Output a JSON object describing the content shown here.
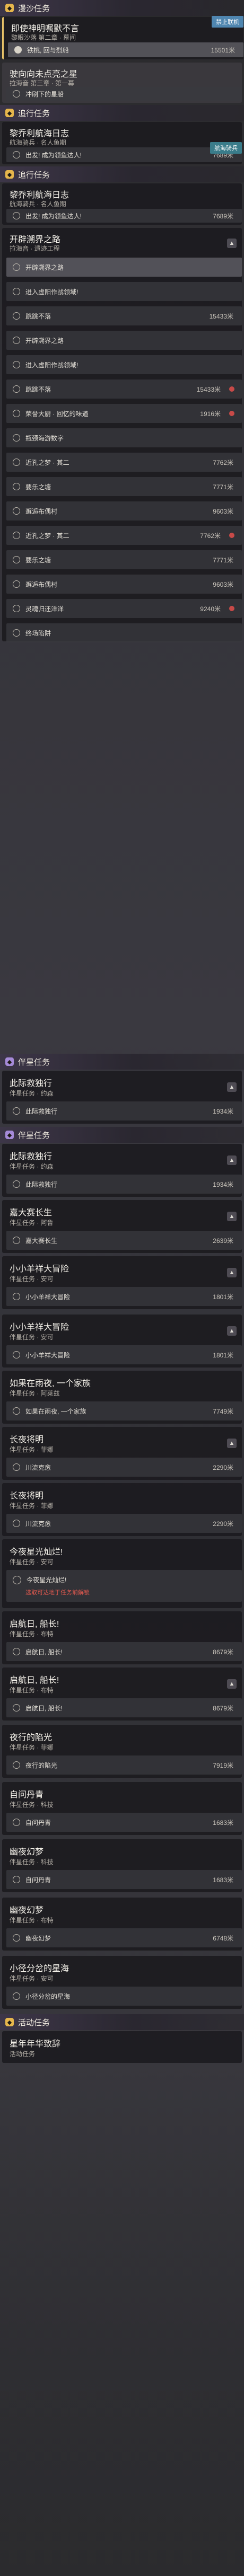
{
  "sections": {
    "side_quests": "漫沙任务",
    "companion": "伴星任务",
    "activity": "活动任务",
    "trail": "追行任务"
  },
  "cards": {
    "c1": {
      "title": "即使神明嘱默不言",
      "sub": "黎眼沙落 第二章 · 幕间",
      "badge": "禁止联机"
    },
    "c1_rows": [
      {
        "text": "铁桃, 回与烈船",
        "num": "15501米"
      }
    ],
    "c2": {
      "title": "驶向向未点亮之星",
      "sub": "拉海音 第三章 · 第一幕"
    },
    "c2_rows": [
      {
        "text": "冲刷下的星船"
      }
    ],
    "c3": {
      "title": "黎乔利航海日志",
      "sub": "航海骑兵 · 名人鱼期",
      "badge": "航海骑兵"
    },
    "c3_rows": [
      {
        "text": "出发! 成为领鱼达人!",
        "num": "7689米"
      }
    ],
    "c4": {
      "title": "黎乔利航海日志",
      "sub": "航海骑兵 · 名人鱼期"
    },
    "c4_rows": [
      {
        "text": "出发! 成为领鱼达人!",
        "num": "7689米"
      }
    ],
    "c5": {
      "title": "开辟溯界之路",
      "sub": "拉海音 · 遗迹工程"
    },
    "c5_rows": [
      {
        "text": "开辟溯界之路"
      },
      {
        "text": "进入虚阳作战领域!"
      },
      {
        "text": "跳跳不落",
        "num": "15433米"
      },
      {
        "text": "开辟溯界之路"
      },
      {
        "text": "进入虚阳作战领域!"
      },
      {
        "text": "跳跳不落",
        "num": "15433米"
      },
      {
        "text": "荣誉大厨 · 回忆的味道",
        "num": "1916米"
      },
      {
        "text": "瓶颈海游数字"
      },
      {
        "text": "近孔之梦 · 其二",
        "num": "7762米"
      },
      {
        "text": "要乐之塘",
        "num": "7771米"
      },
      {
        "text": "邂逅布偶村",
        "num": "9603米"
      },
      {
        "text": "近孔之梦 · 其二",
        "num": "7762米"
      },
      {
        "text": "要乐之塘",
        "num": "7771米"
      },
      {
        "text": "邂逅布偶村",
        "num": "9603米"
      },
      {
        "text": "灵魂归还洋洋",
        "num": "9240米"
      },
      {
        "text": "终场陷阱"
      }
    ],
    "c6": {
      "title": "此际救独行",
      "sub": "伴星任务 · 约森"
    },
    "c6_rows": [
      {
        "text": "此际救独行",
        "num": "1934米"
      }
    ],
    "c7": {
      "title": "此际救独行",
      "sub": "伴星任务 · 约森"
    },
    "c7_rows": [
      {
        "text": "此际救独行",
        "num": "1934米"
      }
    ],
    "c8": {
      "title": "嘉大赛长生",
      "sub": "伴星任务 · 阿鲁"
    },
    "c8_rows": [
      {
        "text": "嘉大赛长生",
        "num": "2639米"
      }
    ],
    "c9": {
      "title": "小小羊祥大冒险",
      "sub": "伴星任务 · 安可"
    },
    "c9_rows": [
      {
        "text": "小小羊祥大冒险",
        "num": "1801米"
      }
    ],
    "c10": {
      "title": "小小羊祥大冒险",
      "sub": "伴星任务 · 安可"
    },
    "c10_rows": [
      {
        "text": "小小羊祥大冒险",
        "num": "1801米"
      }
    ],
    "c11": {
      "title": "如果在雨夜, 一个家族",
      "sub": "伴星任务 · 阿莱兹"
    },
    "c11_rows": [
      {
        "text": "如果在雨夜, 一个家族",
        "num": "7749米"
      }
    ],
    "c12": {
      "title": "长夜将明",
      "sub": "伴星任务 · 菲娜"
    },
    "c12_rows": [
      {
        "text": "川流克愈",
        "num": "2290米"
      }
    ],
    "c13": {
      "title": "长夜将明",
      "sub": "伴星任务 · 菲娜"
    },
    "c13_rows": [
      {
        "text": "川流克愈",
        "num": "2290米"
      }
    ],
    "c14": {
      "title": "今夜星光灿烂!",
      "sub": "伴星任务 · 安可",
      "warn1": "今夜星光灿烂!",
      "warn2": "选取可达地于任务前解锁"
    },
    "c15": {
      "title": "启航日, 船长!",
      "sub": "伴星任务 · 布特"
    },
    "c15_rows": [
      {
        "text": "启航日, 船长!",
        "num": "8679米"
      }
    ],
    "c16": {
      "title": "启航日, 船长!",
      "sub": "伴星任务 · 布特"
    },
    "c16_rows": [
      {
        "text": "启航日, 船长!",
        "num": "8679米"
      }
    ],
    "c17": {
      "title": "夜行的陷光",
      "sub": "伴星任务 · 菲娜"
    },
    "c17_rows": [
      {
        "text": "夜行的陷光",
        "num": "7919米"
      }
    ],
    "c18": {
      "title": "自问丹青",
      "sub": "伴星任务 · 科技"
    },
    "c18_rows": [
      {
        "text": "自问丹青",
        "num": "1683米"
      }
    ],
    "c19": {
      "title": "幽夜幻梦",
      "sub": "伴星任务 · 科技"
    },
    "c19_rows": [
      {
        "text": "自问丹青",
        "num": "1683米"
      }
    ],
    "c20": {
      "title": "幽夜幻梦",
      "sub": "伴星任务 · 布特"
    },
    "c20_rows": [
      {
        "text": "幽夜幻梦",
        "num": "6748米"
      }
    ],
    "c21": {
      "title": "小径分岔的星海",
      "sub": "伴星任务 · 安可"
    },
    "c21_rows": [
      {
        "text": "小径分岔的星海"
      }
    ],
    "c22": {
      "title": "星年年华致辞",
      "sub": "活动任务"
    }
  }
}
